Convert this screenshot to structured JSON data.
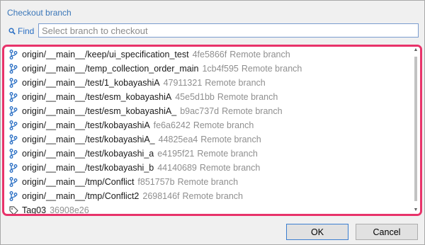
{
  "dialog": {
    "title": "Checkout branch"
  },
  "find": {
    "label": "Find",
    "placeholder": "Select branch to checkout",
    "value": ""
  },
  "branches": [
    {
      "name": "origin/__main__/keep/ui_specification_test",
      "hash": "4fe5866f",
      "kind": "Remote branch",
      "icon": "branch-icon"
    },
    {
      "name": "origin/__main__/temp_collection_order_main",
      "hash": "1cb4f595",
      "kind": "Remote branch",
      "icon": "branch-icon"
    },
    {
      "name": "origin/__main__/test/1_kobayashiA",
      "hash": "47911321",
      "kind": "Remote branch",
      "icon": "branch-icon"
    },
    {
      "name": "origin/__main__/test/esm_kobayashiA",
      "hash": "45e5d1bb",
      "kind": "Remote branch",
      "icon": "branch-icon"
    },
    {
      "name": "origin/__main__/test/esm_kobayashiA_",
      "hash": "b9ac737d",
      "kind": "Remote branch",
      "icon": "branch-icon"
    },
    {
      "name": "origin/__main__/test/kobayashiA",
      "hash": "fe6a6242",
      "kind": "Remote branch",
      "icon": "branch-icon"
    },
    {
      "name": "origin/__main__/test/kobayashiA_",
      "hash": "44825ea4",
      "kind": "Remote branch",
      "icon": "branch-icon"
    },
    {
      "name": "origin/__main__/test/kobayashi_a",
      "hash": "e4195f21",
      "kind": "Remote branch",
      "icon": "branch-icon"
    },
    {
      "name": "origin/__main__/test/kobayashi_b",
      "hash": "44140689",
      "kind": "Remote branch",
      "icon": "branch-icon"
    },
    {
      "name": "origin/__main__/tmp/Conflict",
      "hash": "f851757b",
      "kind": "Remote branch",
      "icon": "branch-icon"
    },
    {
      "name": "origin/__main__/tmp/Conflict2",
      "hash": "2698146f",
      "kind": "Remote branch",
      "icon": "branch-icon"
    },
    {
      "name": "Tag03",
      "hash": "36908e26",
      "kind": "",
      "icon": "tag-icon"
    }
  ],
  "buttons": {
    "ok": "OK",
    "cancel": "Cancel"
  },
  "colors": {
    "accent": "#3a76b8",
    "highlight_border": "#e8336a",
    "branch_icon": "#2a6fc4",
    "muted_text": "#8f8f8f"
  }
}
